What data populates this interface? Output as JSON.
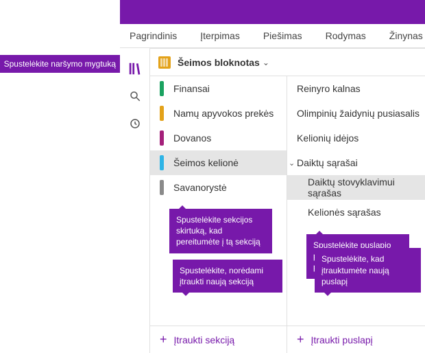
{
  "coach": {
    "nav_button": "Spustelėkite naršymo mygtuką",
    "section_tip": "Spustelėkite sekcijos skirtuką, kad pereitumėte į tą sekciją",
    "page_tip": "Spustelėkite puslapio pavadinimą, kad pereitumėte į tą puslapį",
    "add_section_tip": "Spustelėkite, norėdami įtraukti naują sekciją",
    "add_page_tip": "Spustelėkite, kad įtrauktumėte naują puslapį"
  },
  "ribbon": {
    "tabs": [
      "Pagrindinis",
      "Įterpimas",
      "Piešimas",
      "Rodymas",
      "Žinynas"
    ]
  },
  "notebook": {
    "name": "Šeimos bloknotas"
  },
  "sections": [
    {
      "label": "Finansai",
      "color": "#1aa260"
    },
    {
      "label": "Namų apyvokos prekės",
      "color": "#e3a21a"
    },
    {
      "label": "Dovanos",
      "color": "#a4207a"
    },
    {
      "label": "Šeimos kelionė",
      "color": "#2eb4e6",
      "selected": true
    },
    {
      "label": "Savanorystė",
      "color": "#8a8a8a"
    }
  ],
  "pages": [
    {
      "label": "Reinyro kalnas"
    },
    {
      "label": "Olimpinių žaidynių pusiasalis"
    },
    {
      "label": "Kelionių idėjos"
    },
    {
      "label": "Daiktų sąrašai",
      "expanded": true
    },
    {
      "label": "Daiktų stovyklavimui sąrašas",
      "child": true,
      "selected": true
    },
    {
      "label": "Kelionės sąrašas",
      "child": true
    }
  ],
  "footer": {
    "add_section": "Įtraukti sekciją",
    "add_page": "Įtraukti puslapį"
  }
}
